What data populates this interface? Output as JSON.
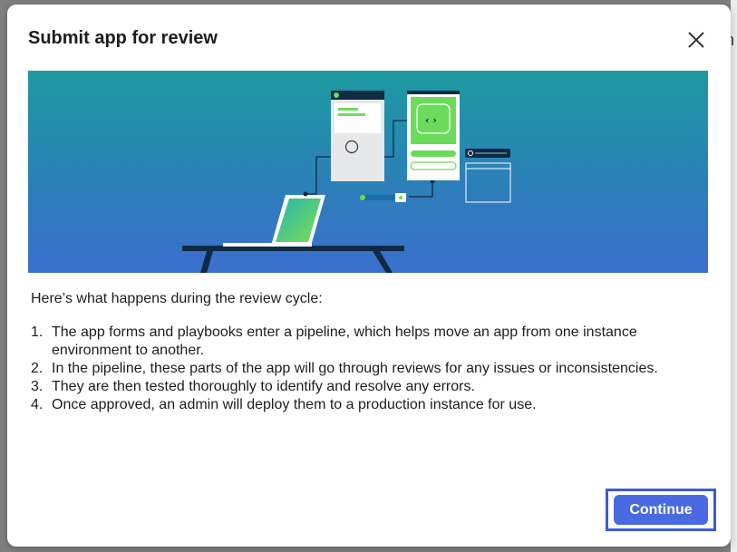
{
  "dialog": {
    "title": "Submit app for review",
    "close_icon": "close-icon"
  },
  "banner": {
    "illustration": "laptop-pipeline-illustration"
  },
  "content": {
    "intro": "Here’s what happens during the review cycle:",
    "steps": [
      {
        "number": "1.",
        "text": "The app forms and playbooks enter a pipeline, which helps move an app from one instance environment to another."
      },
      {
        "number": "2.",
        "text": "In the pipeline, these parts of the app will go through reviews for any issues or inconsistencies."
      },
      {
        "number": "3.",
        "text": "They are then tested thoroughly to identify and resolve any errors."
      },
      {
        "number": "4.",
        "text": "Once approved, an admin will deploy them to a production instance for use."
      }
    ]
  },
  "footer": {
    "continue_label": "Continue"
  },
  "background": {
    "partial_glyph": "n"
  },
  "colors": {
    "primary_button": "#4a6ae2",
    "focus_ring": "#3b5bdb",
    "banner_top": "#1c9aa0",
    "banner_bottom": "#3b6fcf",
    "accent_green": "#6bdc5a"
  }
}
